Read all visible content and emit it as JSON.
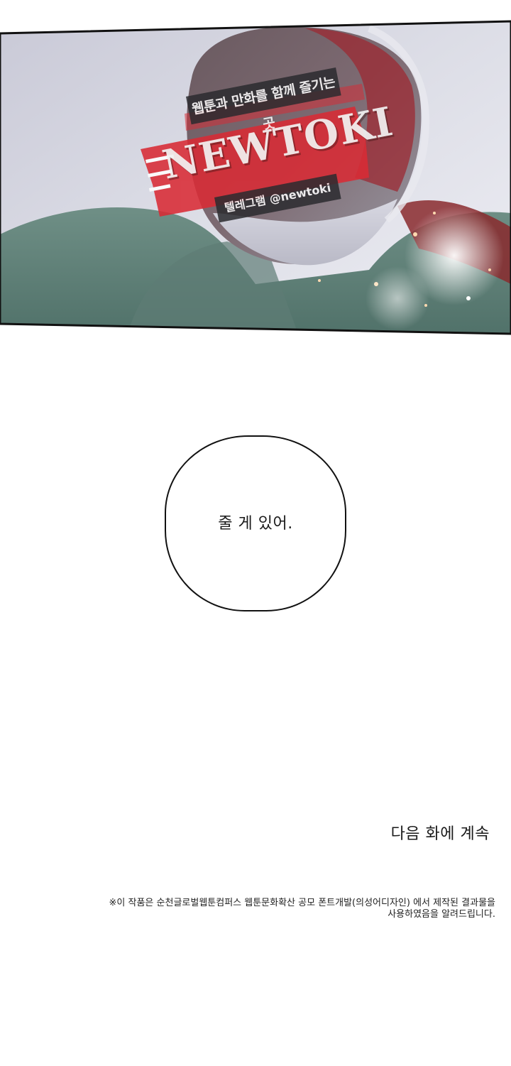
{
  "watermark": {
    "top_line": "웹툰과 만화를 함께 즐기는 곳",
    "brand": "NEWTOKI",
    "sub_line": "텔레그램 @newtoki",
    "accent_color": "#d92b35"
  },
  "bubble": {
    "text": "줄 게 있어."
  },
  "continue_text": "다음 화에 계속",
  "credit": {
    "line1": "※이 작품은 순천글로벌웹툰컴퍼스 웹툰문화확산 공모 폰트개발(의성어디자인) 에서 제작된 결과물을",
    "line2": "사용하였음을 알려드립니다."
  }
}
